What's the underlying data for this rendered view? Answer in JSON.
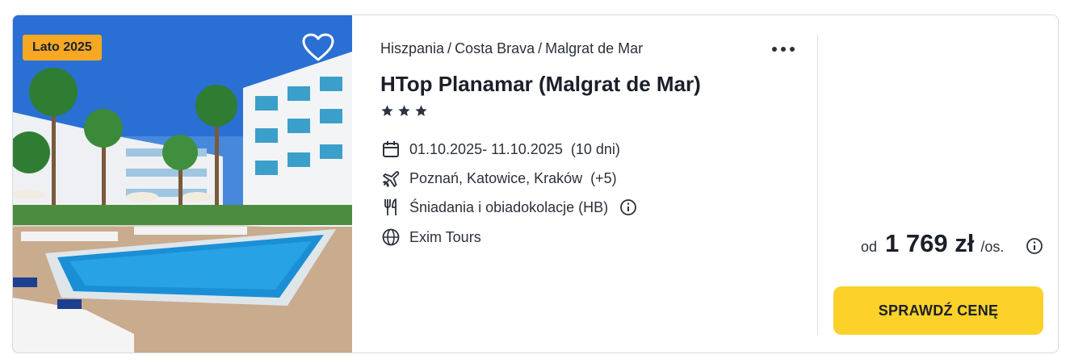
{
  "offer": {
    "badge": "Lato 2025",
    "breadcrumb": [
      "Hiszpania",
      "Costa Brava",
      "Malgrat de Mar"
    ],
    "breadcrumb_separator": "/",
    "title": "HTop Planamar (Malgrat de Mar)",
    "stars": 3,
    "dates": "01.10.2025- 11.10.2025",
    "duration": "(10 dni)",
    "departure": "Poznań, Katowice, Kraków",
    "departure_extra": "(+5)",
    "board": "Śniadania i obiadokolacje (HB)",
    "operator": "Exim Tours"
  },
  "price": {
    "prefix": "od",
    "amount": "1 769 zł",
    "suffix": "/os."
  },
  "cta": {
    "label": "SPRAWDŹ CENĘ"
  },
  "colors": {
    "badge": "#f7a823",
    "cta": "#fbd12a",
    "text": "#1f2430",
    "border": "#d7d9de"
  },
  "icons": {
    "favorite": "heart-icon",
    "more": "more-dots-icon",
    "dates": "calendar-icon",
    "departure": "plane-icon",
    "board": "cutlery-icon",
    "operator": "globe-icon",
    "info": "info-icon"
  }
}
